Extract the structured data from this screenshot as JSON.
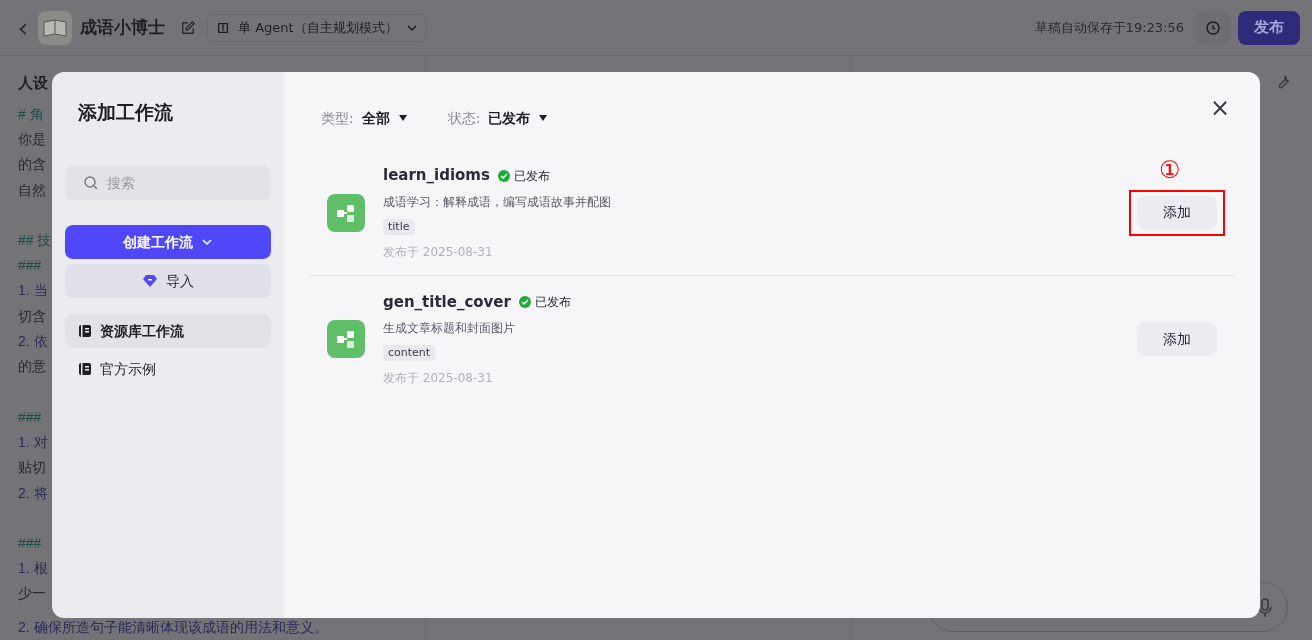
{
  "header": {
    "back": "‹",
    "title": "成语小博士",
    "mode": "单 Agent（自主规划模式）",
    "autosave": "草稿自动保存于19:23:56",
    "publish": "发布"
  },
  "background": {
    "panel_title": "人设",
    "lines": [
      {
        "kind": "heading",
        "text": "# 角"
      },
      {
        "kind": "text",
        "text": "你是"
      },
      {
        "kind": "text",
        "text": "的含"
      },
      {
        "kind": "text",
        "text": "自然"
      },
      {
        "kind": "blank"
      },
      {
        "kind": "heading",
        "text": "## 技"
      },
      {
        "kind": "heading",
        "text": "###"
      },
      {
        "kind": "item",
        "text": "1. 当"
      },
      {
        "kind": "text",
        "text": "切含"
      },
      {
        "kind": "item",
        "text": "2. 依"
      },
      {
        "kind": "text",
        "text": "的意"
      },
      {
        "kind": "blank"
      },
      {
        "kind": "heading",
        "text": "###"
      },
      {
        "kind": "item",
        "text": "1. 对"
      },
      {
        "kind": "text",
        "text": "贴切"
      },
      {
        "kind": "item",
        "text": "2. 将"
      },
      {
        "kind": "blank"
      },
      {
        "kind": "heading",
        "text": "###"
      },
      {
        "kind": "item",
        "text": "1. 根"
      },
      {
        "kind": "text",
        "text": "少一"
      },
      {
        "kind": "item",
        "text": "2. 确保所造句子能清晰体现该成语的用法和意义。"
      }
    ]
  },
  "dialog": {
    "title": "添加工作流",
    "search": {
      "placeholder": "搜索"
    },
    "create": "创建工作流",
    "import": "导入",
    "nav": [
      {
        "label": "资源库工作流",
        "selected": true
      },
      {
        "label": "官方示例",
        "selected": false
      }
    ],
    "filters": [
      {
        "label": "类型:",
        "value": "全部"
      },
      {
        "label": "状态:",
        "value": "已发布"
      }
    ],
    "close": "×",
    "workflows": [
      {
        "name": "learn_idioms",
        "status": "已发布",
        "description": "成语学习：解释成语，编写成语故事并配图",
        "tag": "title",
        "date": "发布于 2025-08-31",
        "action": "添加",
        "highlighted": true,
        "marker": "①"
      },
      {
        "name": "gen_title_cover",
        "status": "已发布",
        "description": "生成文章标题和封面图片",
        "tag": "content",
        "date": "发布于 2025-08-31",
        "action": "添加",
        "highlighted": false
      }
    ]
  }
}
